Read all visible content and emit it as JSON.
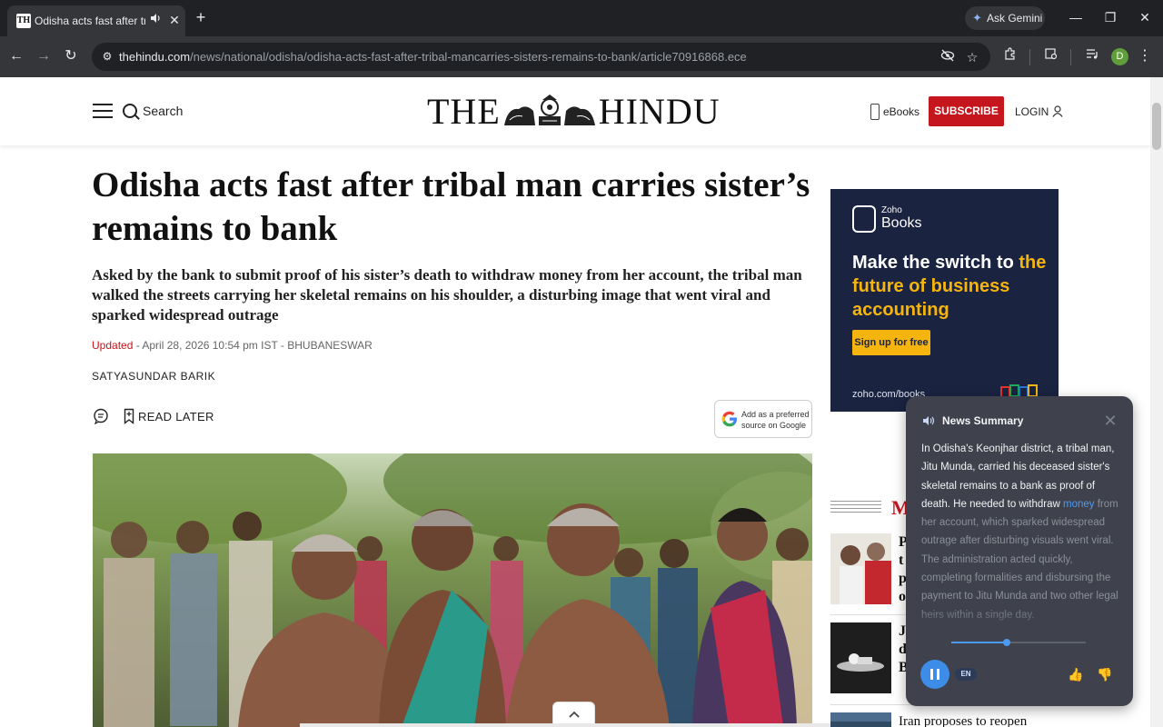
{
  "browser": {
    "tab": {
      "favicon": "TH",
      "title": "Odisha acts fast after tribal",
      "audio_icon": "speaker-icon",
      "close": "✕"
    },
    "new_tab": "+",
    "ask_gemini": "Ask Gemini",
    "window_controls": [
      "—",
      "❐",
      "✕"
    ],
    "url_host": "thehindu.com",
    "url_path": "/news/national/odisha/odisha-acts-fast-after-tribal-mancarries-sisters-remains-to-bank/article70916868.ece",
    "profile_initial": "D"
  },
  "site": {
    "search_label": "Search",
    "logo_left": "THE",
    "logo_right": "HINDU",
    "ebooks_label": "eBooks",
    "subscribe_label": "SUBSCRIBE",
    "login_label": "LOGIN"
  },
  "article": {
    "headline": "Odisha acts fast after tribal man carries sister’s remains to bank",
    "standfirst": "Asked by the bank to submit proof of his sister’s death to withdraw money from her account, the tribal man walked the streets carrying her skeletal remains on his shoulder, a disturbing image that went viral and sparked widespread outrage",
    "updated_label": "Updated",
    "dateline": " - April 28, 2026 10:54 pm IST - BHUBANESWAR",
    "byline": "SATYASUNDAR BARIK",
    "read_later": "READ LATER",
    "google_pref": "Add as a preferred source on Google"
  },
  "ad": {
    "brand_small": "Zoho",
    "brand": "Books",
    "headline_plain": "Make the switch to ",
    "headline_highlight": "the future of business accounting",
    "cta": "Sign up for free",
    "url": "zoho.com/books"
  },
  "sidebar": {
    "section_title_partial": "M",
    "items": [
      {
        "text": "P\nt\np\no"
      },
      {
        "text": "JI\nd\nB"
      },
      {
        "text": "Iran proposes to reopen"
      }
    ]
  },
  "summary": {
    "title": "News Summary",
    "close": "✕",
    "text_read": "In Odisha's Keonjhar district, a tribal man, Jitu Munda, carried his deceased sister's skeletal remains to a bank as proof of death. He needed to withdraw ",
    "text_current": "money",
    "text_unread": " from her account, which sparked widespread outrage after disturbing visuals went viral. The administration acted quickly, completing formalities and disbursing the payment to Jitu Munda and two other legal heirs within a single day.",
    "progress": 0.41,
    "language": "EN",
    "thumbs_up_icon": "thumbs-up-icon",
    "thumbs_down_icon": "thumbs-down-icon"
  },
  "colors": {
    "brand_red": "#c4161c",
    "ad_bg": "#1a2340",
    "ad_accent": "#f6b50e",
    "summary_bg": "#3f424c",
    "summary_accent": "#4d9bf0"
  }
}
